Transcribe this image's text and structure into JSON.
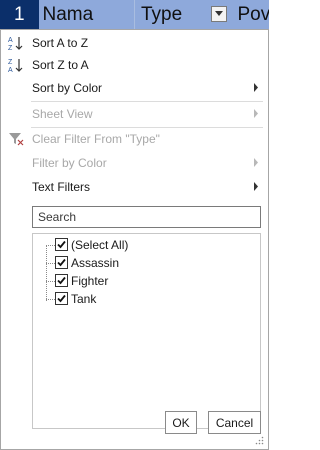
{
  "header": {
    "row_number": "1",
    "col_nama": "Nama",
    "col_type": "Type",
    "col_next": "Pov"
  },
  "menu": {
    "sort_az": "Sort A to Z",
    "sort_za": "Sort Z to A",
    "sort_by_color": "Sort by Color",
    "sheet_view": "Sheet View",
    "clear_filter": "Clear Filter From \"Type\"",
    "filter_by_color": "Filter by Color",
    "text_filters": "Text Filters"
  },
  "search": {
    "placeholder": "Search"
  },
  "list": {
    "items": [
      {
        "label": "(Select All)",
        "checked": true
      },
      {
        "label": "Assassin",
        "checked": true
      },
      {
        "label": "Fighter",
        "checked": true
      },
      {
        "label": "Tank",
        "checked": true
      }
    ]
  },
  "buttons": {
    "ok": "OK",
    "cancel": "Cancel"
  },
  "colors": {
    "header_bg": "#8ea9db",
    "row_num_bg": "#0b2f6a"
  }
}
